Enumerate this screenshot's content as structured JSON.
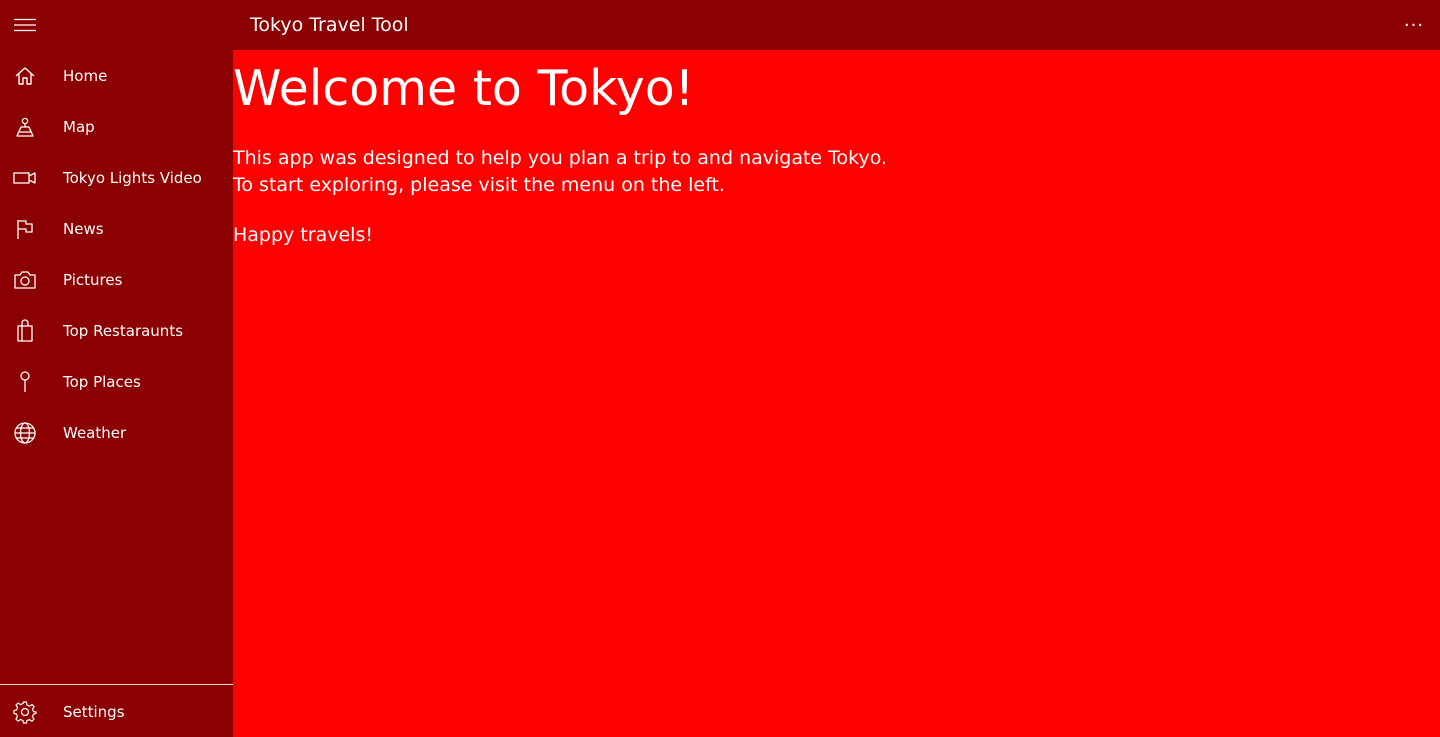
{
  "titlebar": {
    "title": "Tokyo Travel Tool",
    "menu_icon": "hamburger-icon",
    "more_label": "···"
  },
  "nav": {
    "items": [
      {
        "label": "Home",
        "icon": "home-icon"
      },
      {
        "label": "Map",
        "icon": "map-icon"
      },
      {
        "label": "Tokyo Lights Video",
        "icon": "video-icon"
      },
      {
        "label": "News",
        "icon": "flag-icon"
      },
      {
        "label": "Pictures",
        "icon": "camera-icon"
      },
      {
        "label": "Top Restaraunts",
        "icon": "shopping-bag-icon"
      },
      {
        "label": "Top Places",
        "icon": "pin-icon"
      },
      {
        "label": "Weather",
        "icon": "globe-icon"
      }
    ],
    "settings": {
      "label": "Settings",
      "icon": "gear-icon"
    }
  },
  "main": {
    "heading": "Welcome to Tokyo!",
    "lines": [
      "This app was designed to help you plan a trip to and navigate Tokyo.",
      "To start exploring, please visit the menu on the left.",
      "Happy travels!"
    ]
  },
  "colors": {
    "pane_background": "#8B0000",
    "content_background": "#FF0000",
    "text": "#FFFFFF"
  }
}
